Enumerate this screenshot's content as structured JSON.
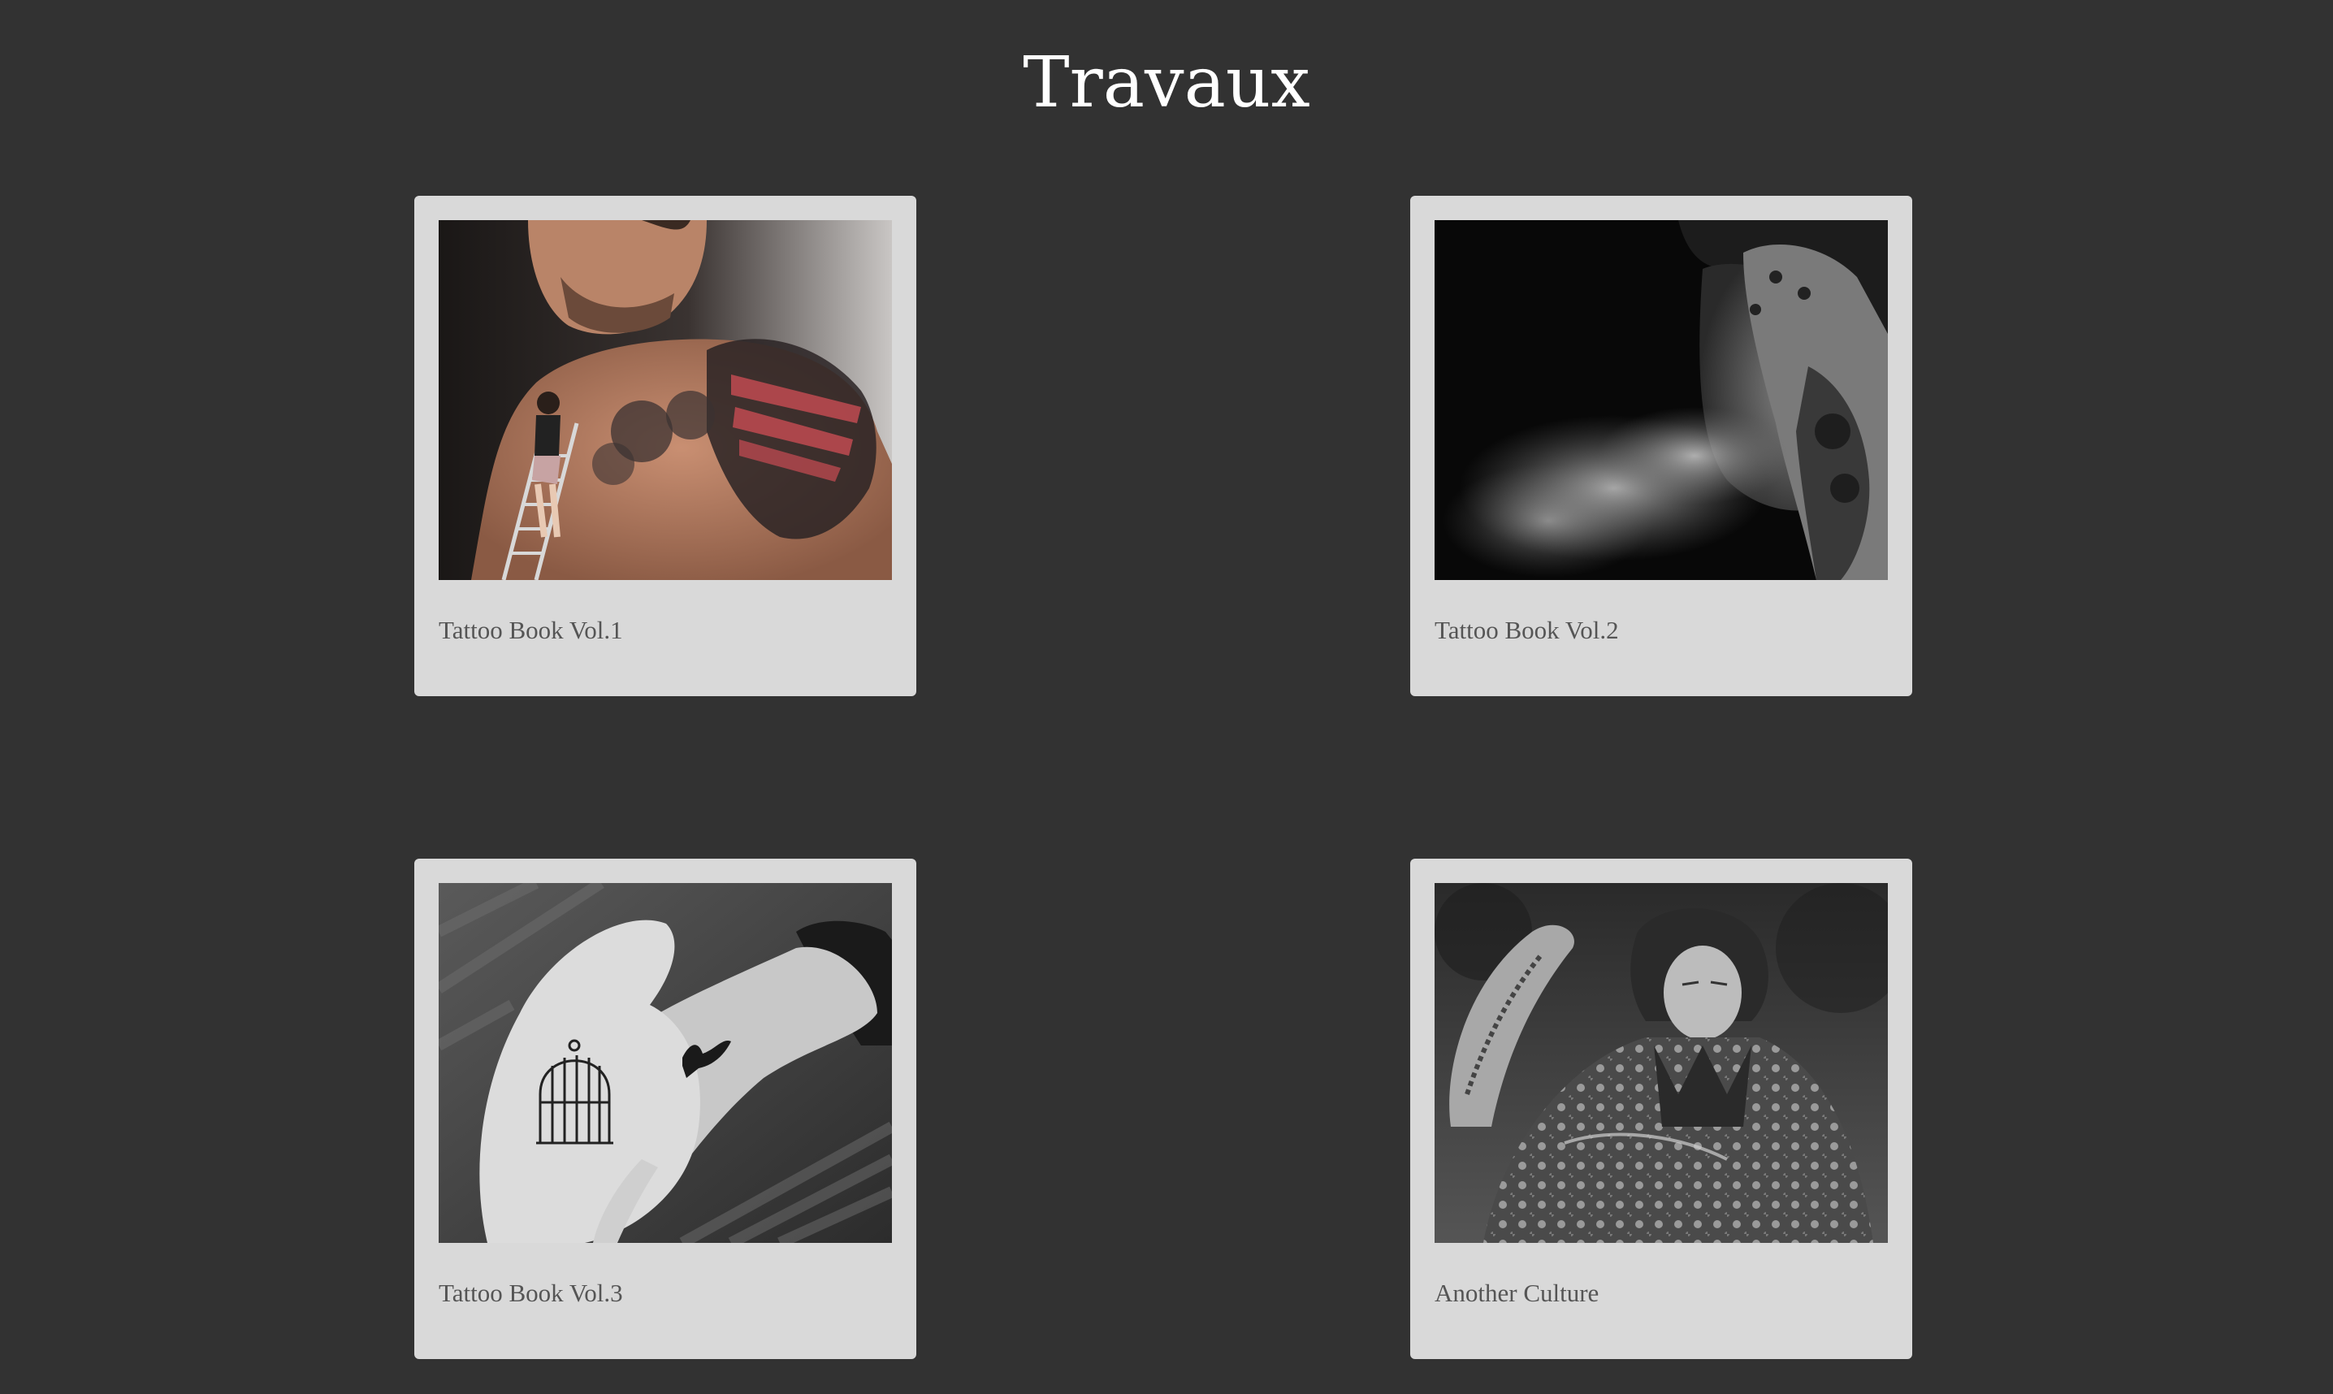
{
  "page": {
    "title": "Travaux",
    "background_color": "#323232"
  },
  "gallery": {
    "card_color": "#d9d9d9",
    "caption_color": "#555555",
    "items": [
      {
        "caption": "Tattoo Book Vol.1",
        "image": "tattooed-man-chest-photo"
      },
      {
        "caption": "Tattoo Book Vol.2",
        "image": "woman-smoke-tattooed-hand-photo"
      },
      {
        "caption": "Tattoo Book Vol.3",
        "image": "hands-birdcage-bird-tattoo-photo"
      },
      {
        "caption": "Another Culture",
        "image": "woman-henna-traditional-dress-photo"
      }
    ]
  }
}
